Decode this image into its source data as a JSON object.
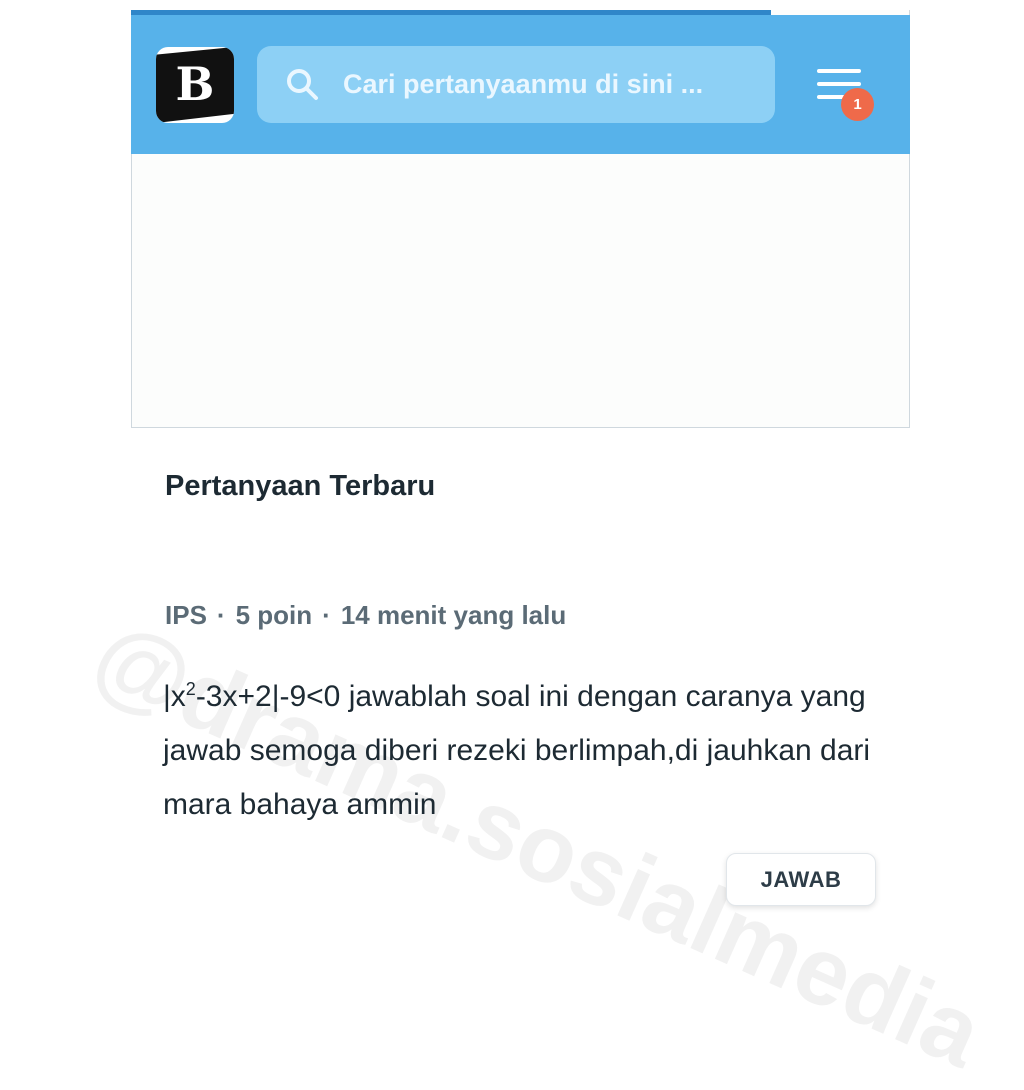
{
  "header": {
    "logo_letter": "B",
    "search": {
      "placeholder": "Cari pertanyaanmu di sini ..."
    },
    "menu_badge": "1"
  },
  "section": {
    "title": "Pertanyaan Terbaru"
  },
  "question": {
    "subject": "IPS",
    "separator": "·",
    "points": "5 poin",
    "time": "14 menit yang lalu",
    "text_pre": "|x",
    "text_sup": "2",
    "text_post": "-3x+2|-9<0 jawablah soal ini dengan caranya yang jawab semoga diberi rezeki berlimpah,di jauhkan dari mara bahaya ammin",
    "answer_label": "JAWAB"
  },
  "watermark": "@drama.sosialmedia",
  "colors": {
    "header_bg": "#57b2ea",
    "search_bg": "#8dd0f5",
    "badge": "#ef6a4a"
  },
  "icons": {
    "search": "search-icon",
    "menu": "menu-icon"
  }
}
